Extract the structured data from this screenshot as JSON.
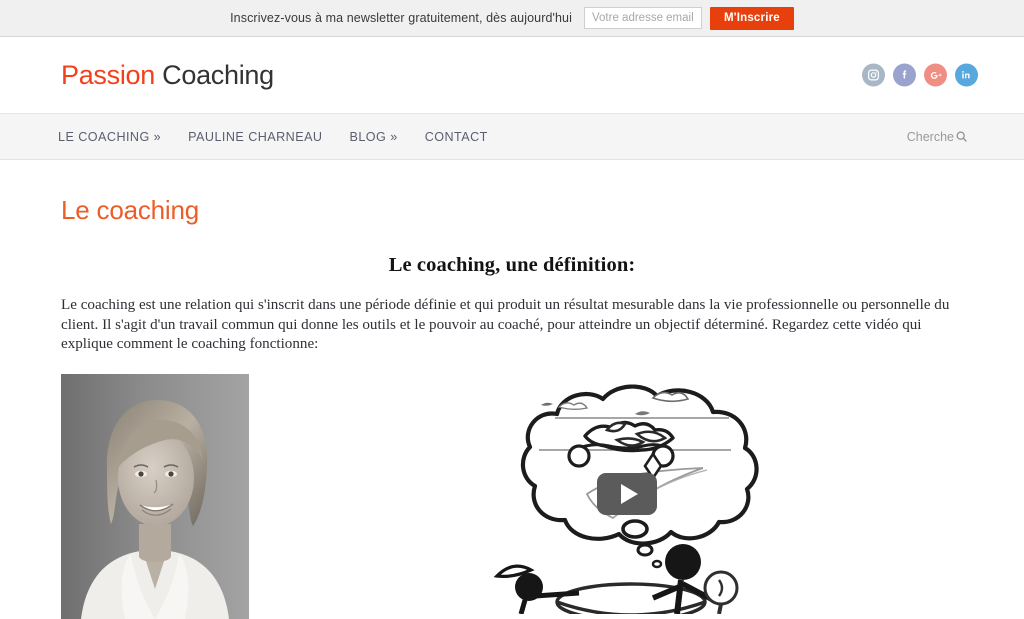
{
  "newsletter": {
    "text": "Inscrivez-vous à ma newsletter gratuitement, dès aujourd'hui",
    "email_placeholder": "Votre adresse email ici",
    "email_value": "",
    "submit_label": "M'Inscrire",
    "button_color": "#e8400c",
    "bar_color": "#f0f0f0"
  },
  "header": {
    "logo_first": "Passion",
    "logo_second": "Coaching",
    "logo_first_color": "#f4401a",
    "logo_second_color": "#333333",
    "social": [
      {
        "name": "instagram-icon",
        "label": "Instagram",
        "color": "#a8b7c6"
      },
      {
        "name": "facebook-icon",
        "label": "Facebook",
        "color": "#9aa3cd"
      },
      {
        "name": "googleplus-icon",
        "label": "Google Plus",
        "color": "#ef8f84"
      },
      {
        "name": "linkedin-icon",
        "label": "LinkedIn",
        "color": "#57a8dc"
      }
    ]
  },
  "nav": {
    "items": [
      {
        "label": "LE COACHING »",
        "name": "nav-item-le-coaching"
      },
      {
        "label": "PAULINE CHARNEAU",
        "name": "nav-item-pauline-charneau"
      },
      {
        "label": "BLOG »",
        "name": "nav-item-blog"
      },
      {
        "label": "CONTACT",
        "name": "nav-item-contact"
      }
    ],
    "search_label": "Cherche",
    "bar_color": "#f5f5f5"
  },
  "main": {
    "page_title": "Le coaching",
    "page_title_color": "#ee5d28",
    "section_heading": "Le coaching, une définition:",
    "paragraph": "Le coaching est une relation qui s'inscrit dans une période définie et qui produit un résultat mesurable dans la vie professionnelle ou personnelle du client. Il s'agit d'un travail commun qui donne les outils et le pouvoir au coaché, pour atteindre un objectif déterminé. Regardez cette vidéo qui explique comment le coaching fonctionne:",
    "portrait_alt": "Portrait noir et blanc d'une femme souriante",
    "video_alt": "Vignette vidéo: dessin au tableau blanc avec bulle de pensée et personnages bâtons autour d'une table",
    "video_play_label": "Lire la vidéo"
  }
}
